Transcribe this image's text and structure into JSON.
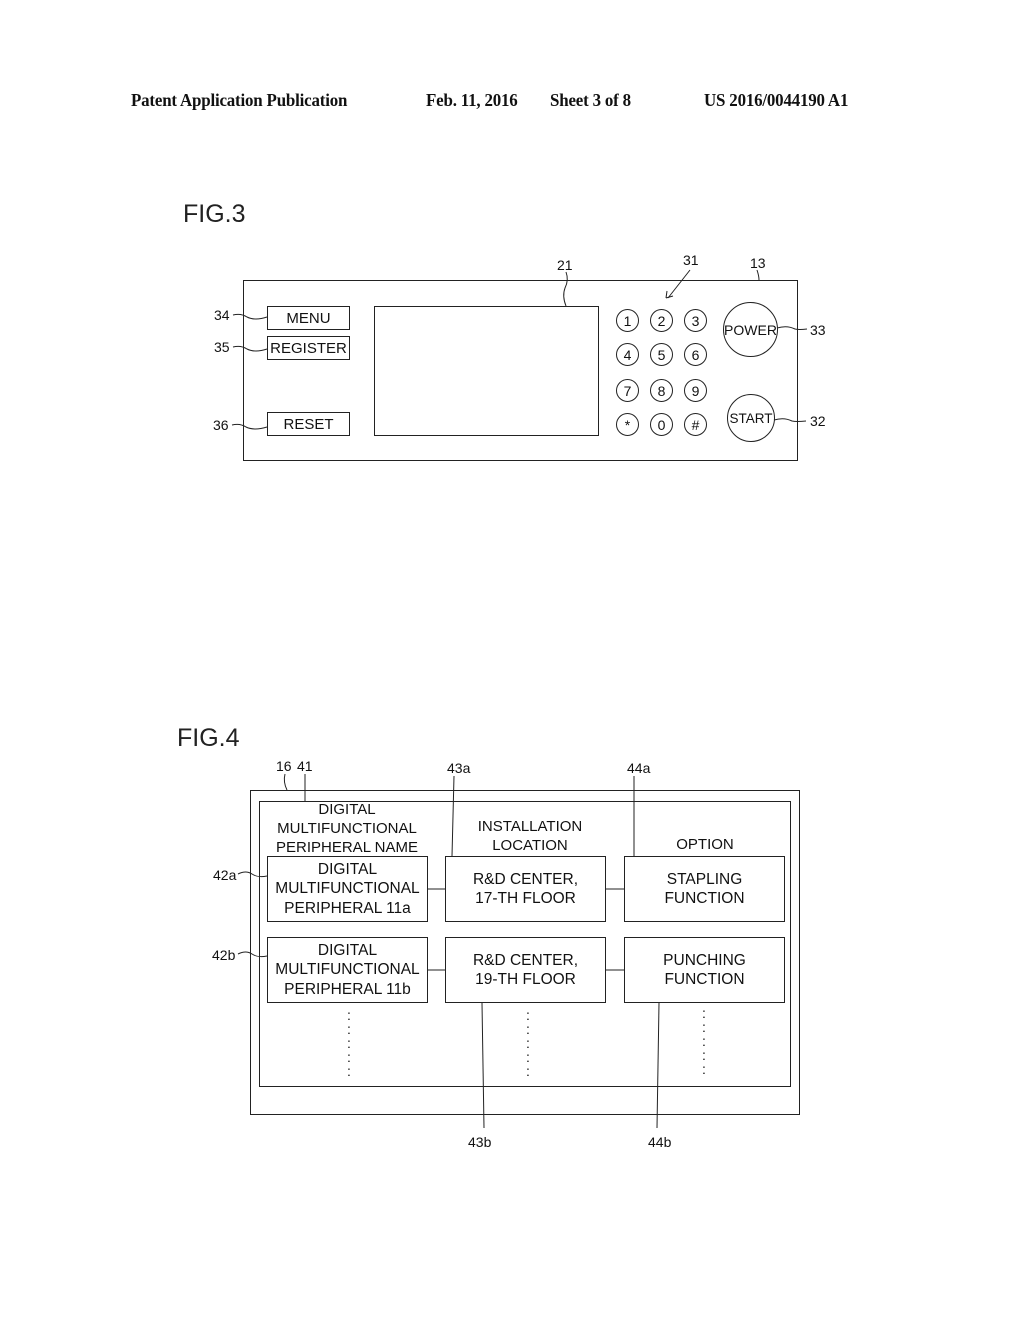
{
  "header": {
    "publication_type": "Patent Application Publication",
    "date": "Feb. 11, 2016",
    "sheet": "Sheet 3 of 8",
    "publication_number": "US 2016/0044190 A1"
  },
  "fig3": {
    "label": "FIG.3",
    "refs": {
      "panel": "13",
      "display": "21",
      "keypad": "31",
      "start": "32",
      "power": "33",
      "menu": "34",
      "register": "35",
      "reset": "36"
    },
    "buttons": {
      "menu": "MENU",
      "register": "REGISTER",
      "reset": "RESET",
      "power": "POWER",
      "start": "START"
    },
    "keypad": [
      "1",
      "2",
      "3",
      "4",
      "5",
      "6",
      "7",
      "8",
      "9",
      "*",
      "0",
      "#"
    ]
  },
  "fig4": {
    "label": "FIG.4",
    "refs": {
      "screen": "16",
      "list": "41",
      "row_a": "42a",
      "row_b": "42b",
      "location_a": "43a",
      "location_b": "43b",
      "option_a": "44a",
      "option_b": "44b"
    },
    "columns": {
      "name": [
        "DIGITAL",
        "MULTIFUNCTIONAL",
        "PERIPHERAL NAME"
      ],
      "location": [
        "INSTALLATION",
        "LOCATION"
      ],
      "option": [
        "OPTION"
      ]
    },
    "rows": [
      {
        "name": [
          "DIGITAL",
          "MULTIFUNCTIONAL",
          "PERIPHERAL 11a"
        ],
        "location": [
          "R&D CENTER,",
          "17-TH FLOOR"
        ],
        "option": [
          "STAPLING",
          "FUNCTION"
        ]
      },
      {
        "name": [
          "DIGITAL",
          "MULTIFUNCTIONAL",
          "PERIPHERAL 11b"
        ],
        "location": [
          "R&D CENTER,",
          "19-TH FLOOR"
        ],
        "option": [
          "PUNCHING",
          "FUNCTION"
        ]
      }
    ],
    "continuation": ":"
  }
}
